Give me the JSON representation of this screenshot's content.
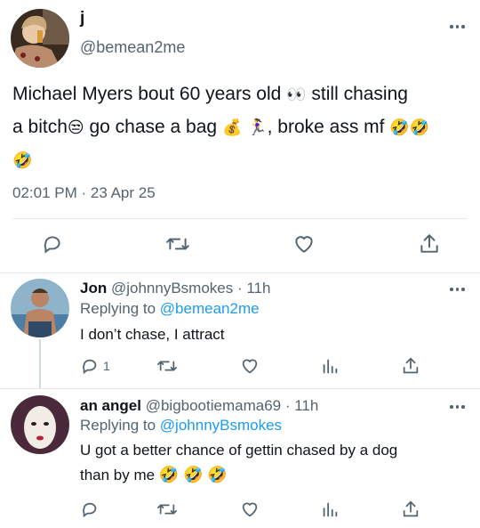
{
  "main_tweet": {
    "name": "j",
    "handle": "@bemean2me",
    "text_line1": "Michael Myers bout 60 years old",
    "emoji_eyes": "👀",
    "text_line1b": " still chasing",
    "text_line2a": "a bitch",
    "emoji_unamused": "😒",
    "text_line2b": " go chase a bag ",
    "emoji_moneybag": "💰",
    "emoji_runner": "🏃‍♀️",
    "text_line2c": ", broke ass mf ",
    "emoji_laugh": "🤣",
    "timestamp": "02:01 PM · 23 Apr 25"
  },
  "replies": [
    {
      "name": "Jon",
      "handle": "@johnnyBsmokes",
      "time": "· 11h",
      "replying_label": "Replying to",
      "replying_to": "@bemean2me",
      "text": "I don’t chase, I attract",
      "reply_count": "1"
    },
    {
      "name": "an angel",
      "handle": "@bigbootiemama69",
      "time": "· 11h",
      "replying_label": "Replying to",
      "replying_to": "@johnnyBsmokes",
      "text_line1": "U got a better chance of gettin chased by a dog",
      "text_line2": "than by me",
      "emoji_laugh": "🤣"
    }
  ],
  "colors": {
    "text": "#0f1419",
    "secondary": "#536471",
    "link": "#1d9bf0",
    "divider": "#e6e9ec"
  },
  "icons": [
    "more-icon",
    "reply-icon",
    "retweet-icon",
    "like-icon",
    "share-icon",
    "views-icon"
  ]
}
